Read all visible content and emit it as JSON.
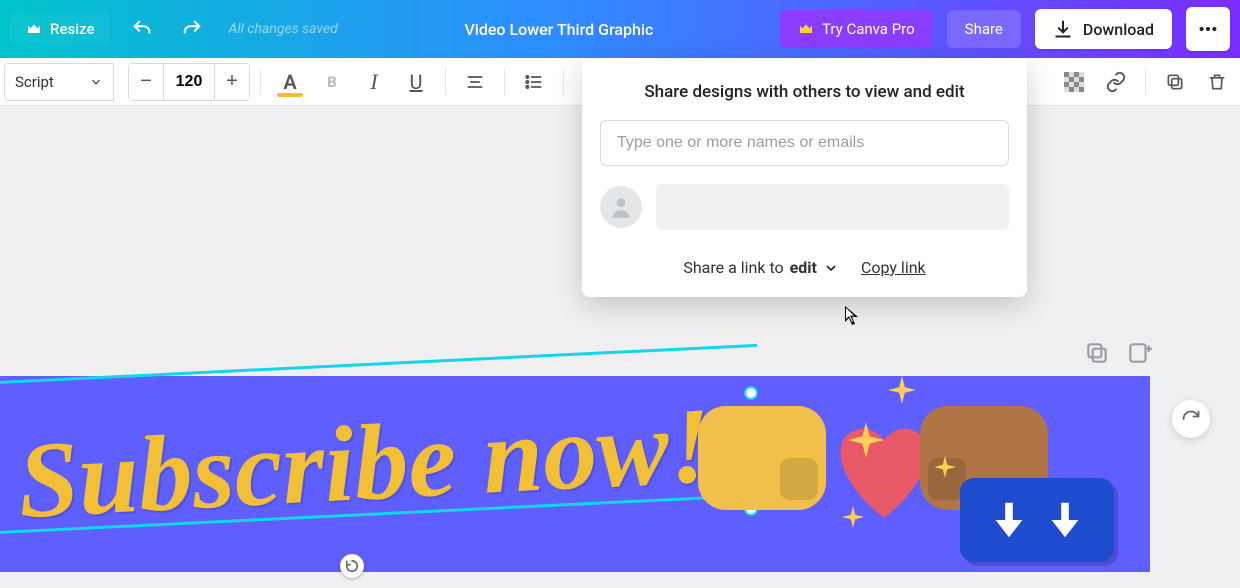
{
  "topbar": {
    "resize_label": "Resize",
    "saved_msg": "All changes saved",
    "doc_title": "Video Lower Third Graphic",
    "try_pro_label": "Try Canva Pro",
    "share_label": "Share",
    "download_label": "Download"
  },
  "font_toolbar": {
    "font_name": "Script",
    "font_size": "120"
  },
  "share_popover": {
    "title": "Share designs with others to view and edit",
    "input_placeholder": "Type one or more names or emails",
    "link_prefix": "Share a link to ",
    "link_perm": "edit",
    "copy_label": "Copy link"
  },
  "canvas": {
    "headline": "Subscribe now!"
  }
}
